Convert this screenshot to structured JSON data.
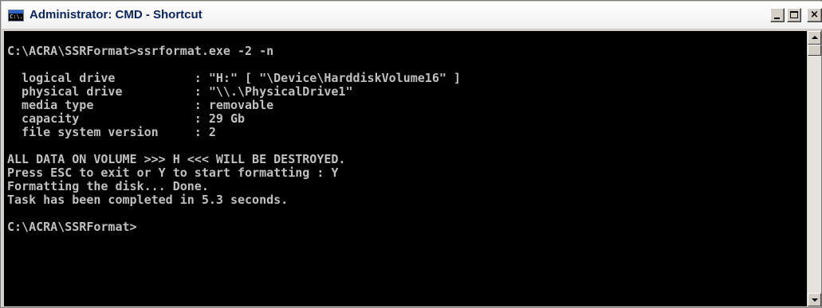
{
  "window": {
    "title": "Administrator: CMD - Shortcut",
    "icon": "cmd-console-icon",
    "icon_text": "C:\\.",
    "buttons": {
      "minimize": "minimize-icon",
      "maximize": "maximize-icon",
      "close_label": "×"
    }
  },
  "console": {
    "lines": [
      "C:\\ACRA\\SSRFormat>ssrformat.exe -2 -n",
      "",
      "  logical drive           : \"H:\" [ \"\\Device\\HarddiskVolume16\" ]",
      "  physical drive          : \"\\\\.\\PhysicalDrive1\"",
      "  media type              : removable",
      "  capacity                : 29 Gb",
      "  file system version     : 2",
      "",
      "ALL DATA ON VOLUME >>> H <<< WILL BE DESTROYED.",
      "Press ESC to exit or Y to start formatting : Y",
      "Formatting the disk... Done.",
      "Task has been completed in 5.3 seconds.",
      "",
      "C:\\ACRA\\SSRFormat>"
    ]
  },
  "colors": {
    "console_background": "#000000",
    "console_text": "#c0c0c0",
    "title_text": "#0a246a"
  }
}
